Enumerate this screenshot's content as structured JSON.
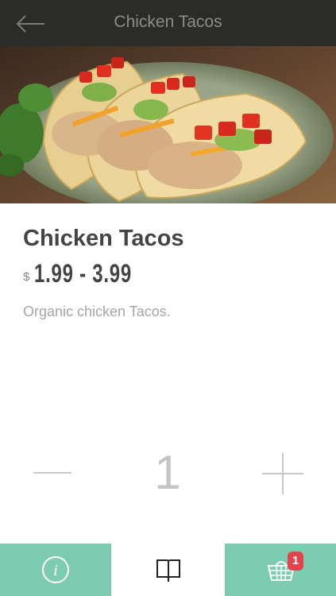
{
  "header": {
    "title": "Chicken Tacos",
    "back_icon": "arrow-left-icon"
  },
  "hero": {
    "image": "chicken-tacos-photo"
  },
  "product": {
    "name": "Chicken Tacos",
    "currency": "$",
    "price_range": "1.99 - 3.99",
    "description": "Organic chicken Tacos."
  },
  "quantity": {
    "value": "1",
    "decrement_icon": "minus-icon",
    "increment_icon": "plus-icon"
  },
  "tabbar": {
    "tabs": [
      {
        "icon": "info-icon",
        "active": false
      },
      {
        "icon": "book-icon",
        "active": true
      },
      {
        "icon": "basket-icon",
        "active": false
      }
    ],
    "cart_count": "1"
  },
  "colors": {
    "header_bg": "#2b2b28",
    "accent": "#7dcbb0",
    "badge": "#e0454e"
  }
}
